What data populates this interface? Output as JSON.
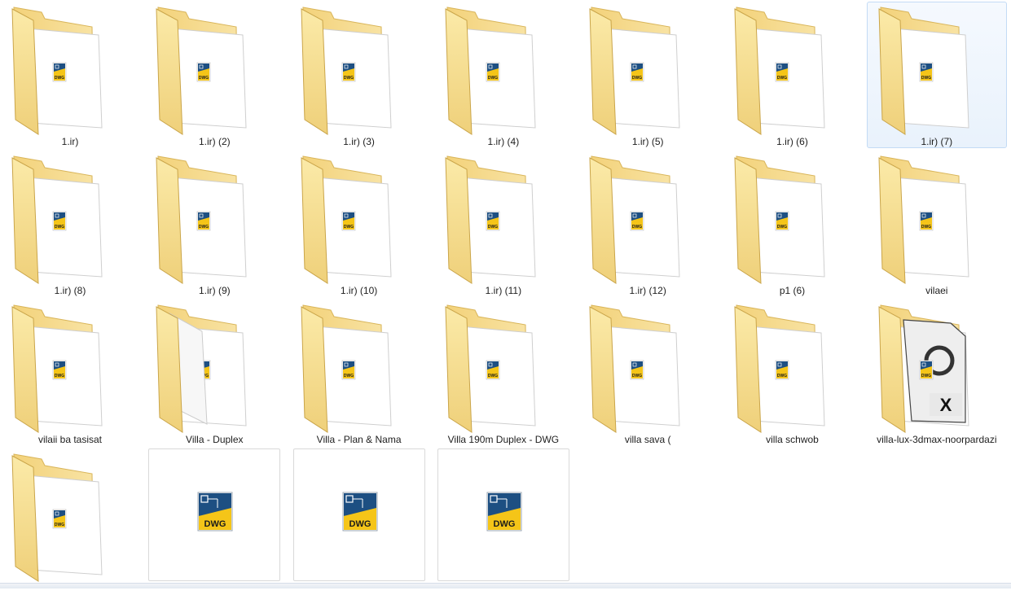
{
  "explorer": {
    "folders": [
      {
        "name": "1.ir)",
        "preview": "dwg"
      },
      {
        "name": "1.ir) (2)",
        "preview": "dwg"
      },
      {
        "name": "1.ir) (3)",
        "preview": "dwg"
      },
      {
        "name": "1.ir) (4)",
        "preview": "dwg"
      },
      {
        "name": "1.ir) (5)",
        "preview": "dwg"
      },
      {
        "name": "1.ir) (6)",
        "preview": "dwg"
      },
      {
        "name": "1.ir) (7)",
        "preview": "dwg",
        "selected": true
      },
      {
        "name": "1.ir) (8)",
        "preview": "dwg"
      },
      {
        "name": "1.ir) (9)",
        "preview": "dwg"
      },
      {
        "name": "1.ir) (10)",
        "preview": "dwg"
      },
      {
        "name": "1.ir) (11)",
        "preview": "dwg"
      },
      {
        "name": "1.ir) (12)",
        "preview": "dwg"
      },
      {
        "name": "p1 (6)",
        "preview": "dwg"
      },
      {
        "name": "vilaei",
        "preview": "dwg"
      },
      {
        "name": "vilaii ba tasisat",
        "preview": "dwg"
      },
      {
        "name": "Villa - Duplex",
        "preview": "dwg-sheet"
      },
      {
        "name": "Villa - Plan & Nama",
        "preview": "dwg"
      },
      {
        "name": "Villa 190m Duplex - DWG",
        "preview": "dwg"
      },
      {
        "name": "villa sava (",
        "preview": "dwg"
      },
      {
        "name": "villa schwob",
        "preview": "dwg"
      },
      {
        "name": "villa-lux-3dmax-noorpardazi",
        "preview": "3dsmax"
      },
      {
        "name": "",
        "preview": "dwg"
      }
    ],
    "files": [
      {
        "icon": "dwg-file-icon",
        "badge": "DWG"
      },
      {
        "icon": "dwg-file-icon",
        "badge": "DWG"
      },
      {
        "icon": "dwg-file-icon",
        "badge": "DWG"
      }
    ],
    "colors": {
      "folder_body": "#f6dc8a",
      "folder_tab": "#efcf72",
      "selection_border": "#c3dbf5",
      "dwg_blue": "#1d4f82",
      "dwg_yellow": "#f5c518"
    }
  }
}
